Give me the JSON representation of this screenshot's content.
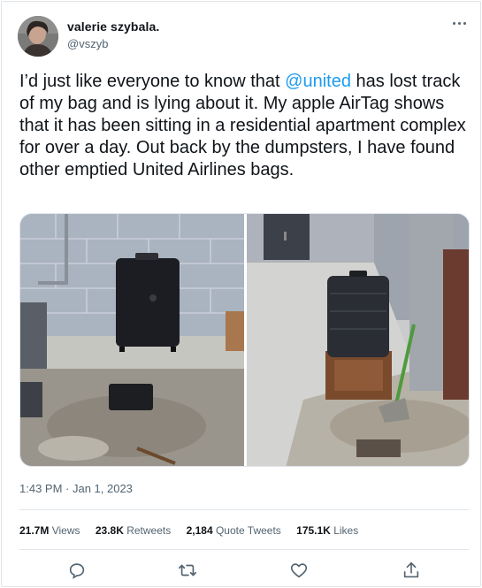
{
  "user": {
    "name": "valerie szybala.",
    "handle": "@vszyb"
  },
  "tweet": {
    "text_before": "I’d just like everyone to know that ",
    "mention": "@united",
    "text_after": " has lost track of my bag and is lying about it. My apple AirTag shows that it has been sitting in a residential apartment complex for over a day. Out back by the dumpsters, I have found other emptied United Airlines bags.",
    "timestamp": "1:43 PM · Jan 1, 2023"
  },
  "stats": [
    {
      "value": "21.7M",
      "label": "Views"
    },
    {
      "value": "23.8K",
      "label": "Retweets"
    },
    {
      "value": "2,184",
      "label": "Quote Tweets"
    },
    {
      "value": "175.1K",
      "label": "Likes"
    }
  ],
  "icons": {
    "more": "more-dots-icon",
    "reply": "reply-icon",
    "retweet": "retweet-icon",
    "like": "like-icon",
    "share": "share-icon"
  },
  "colors": {
    "mention": "#1d9bf0",
    "secondary_text": "#536471",
    "divider": "#dfe5ea"
  }
}
